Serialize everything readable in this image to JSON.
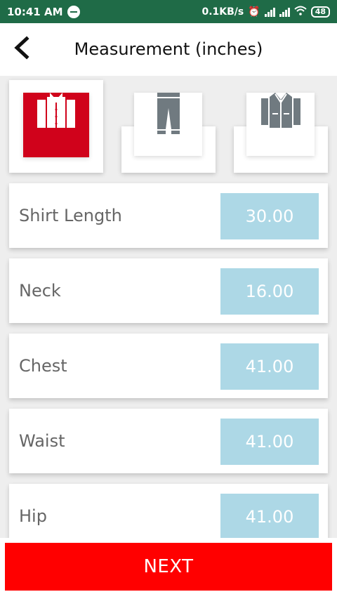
{
  "status_bar": {
    "time": "10:41 AM",
    "net_speed": "0.1KB/s",
    "battery": "48"
  },
  "header": {
    "title": "Measurement (inches)"
  },
  "garments": [
    {
      "name": "shirt",
      "selected": true
    },
    {
      "name": "trousers",
      "selected": false
    },
    {
      "name": "jacket",
      "selected": false
    }
  ],
  "measurements": [
    {
      "label": "Shirt Length",
      "value": "30.00"
    },
    {
      "label": "Neck",
      "value": "16.00"
    },
    {
      "label": "Chest",
      "value": "41.00"
    },
    {
      "label": "Waist",
      "value": "41.00"
    },
    {
      "label": "Hip",
      "value": "41.00"
    }
  ],
  "footer": {
    "next_label": "NEXT"
  },
  "colors": {
    "status_bar": "#1f6b47",
    "active_tab": "#d0021b",
    "value_box": "#add8e6",
    "next_button": "#ff0000"
  }
}
